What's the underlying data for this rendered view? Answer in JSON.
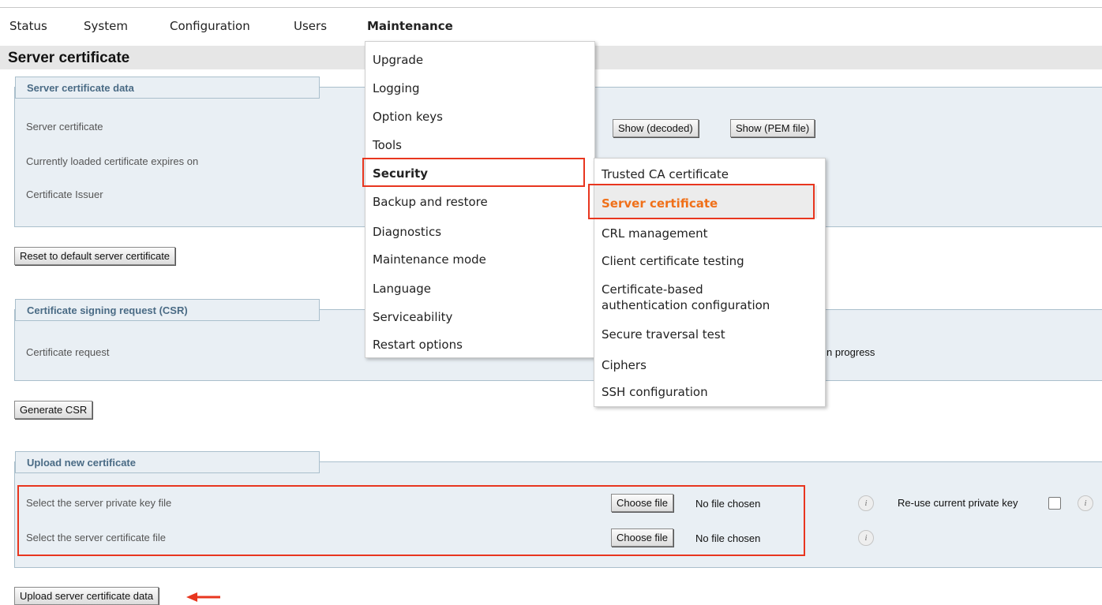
{
  "nav": {
    "items": [
      "Status",
      "System",
      "Configuration",
      "Users",
      "Maintenance"
    ],
    "active": "Maintenance"
  },
  "page": {
    "title": "Server certificate"
  },
  "server_cert_section": {
    "legend": "Server certificate data",
    "rows": [
      {
        "label": "Server certificate"
      },
      {
        "label": "Currently loaded certificate expires on"
      },
      {
        "label": "Certificate Issuer"
      }
    ],
    "buttons": {
      "show_decoded": "Show (decoded)",
      "show_pem": "Show (PEM file)"
    }
  },
  "reset_button": "Reset to default server certificate",
  "csr_section": {
    "legend": "Certificate signing request (CSR)",
    "label": "Certificate request",
    "status_fragment": "n progress"
  },
  "generate_csr_button": "Generate CSR",
  "upload_section": {
    "legend": "Upload new certificate",
    "rows": [
      {
        "label": "Select the server private key file",
        "button": "Choose file",
        "status": "No file chosen"
      },
      {
        "label": "Select the server certificate file",
        "button": "Choose file",
        "status": "No file chosen"
      }
    ],
    "reuse_label": "Re-use current private key",
    "info_glyph": "i"
  },
  "upload_button": "Upload server certificate data",
  "maintenance_menu": [
    "Upgrade",
    "Logging",
    "Option keys",
    "Tools",
    "Security",
    "Backup and restore",
    "Diagnostics",
    "Maintenance mode",
    "Language",
    "Serviceability",
    "Restart options"
  ],
  "security_submenu": {
    "items": [
      "Trusted CA certificate",
      "Server certificate",
      "CRL management",
      "Client certificate testing",
      "Certificate-based",
      "authentication configuration",
      "Secure traversal test",
      "Ciphers",
      "SSH configuration"
    ],
    "selected": "Server certificate"
  },
  "colors": {
    "highlight": "#e8361f",
    "accent_orange": "#f07019",
    "section_bg": "#e9eff4",
    "legend_text": "#4a6b85"
  }
}
